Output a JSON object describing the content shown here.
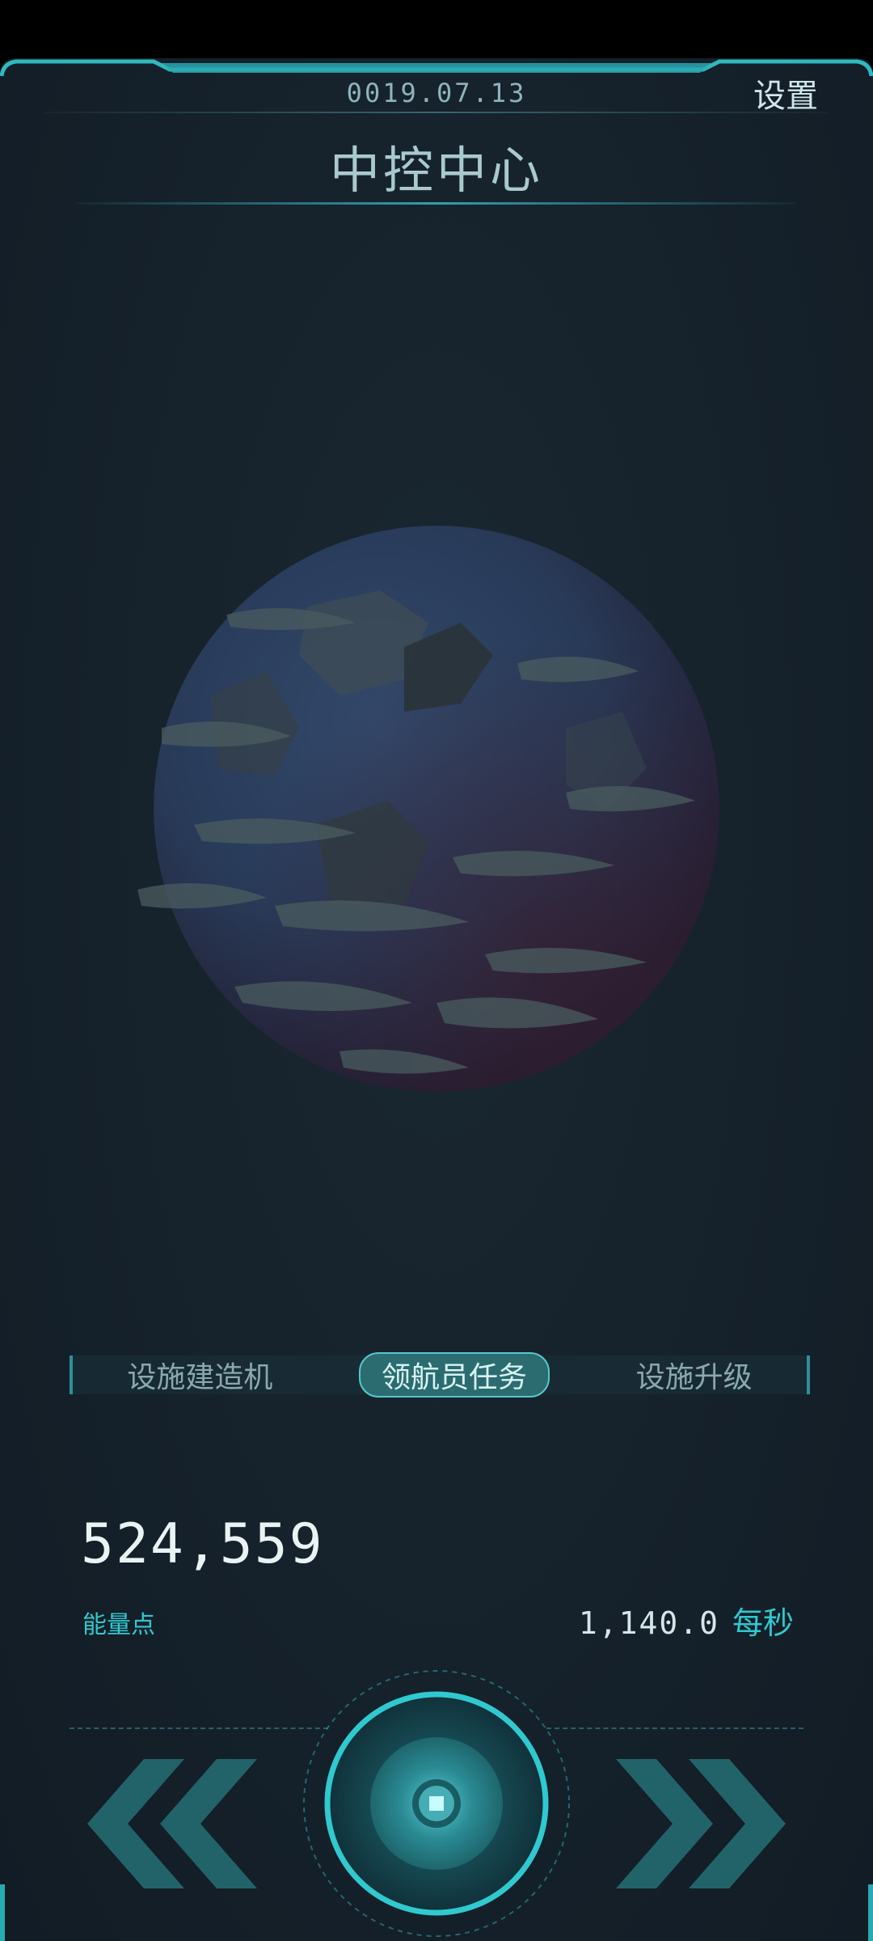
{
  "header": {
    "date": "0019.07.13",
    "settings_label": "设置",
    "title": "中控中心"
  },
  "tabs": [
    {
      "label": "设施建造机",
      "active": false
    },
    {
      "label": "领航员任务",
      "active": true
    },
    {
      "label": "设施升级",
      "active": false
    }
  ],
  "stats": {
    "energy_value": "524,559",
    "energy_label": "能量点",
    "rate_value": "1,140.0",
    "rate_unit": "每秒"
  },
  "controls": {
    "prev_icon": "double-chevron-left-icon",
    "next_icon": "double-chevron-right-icon",
    "core_icon": "core-button-icon"
  },
  "colors": {
    "accent": "#2fc9cf",
    "background": "#15212b",
    "frame": "#2aa8b0"
  }
}
